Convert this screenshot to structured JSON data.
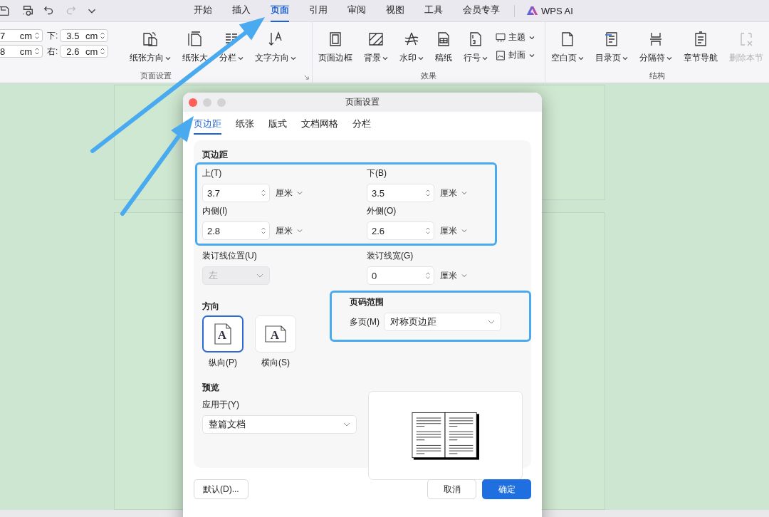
{
  "menu_tabs": [
    {
      "label": "开始",
      "selected": false
    },
    {
      "label": "插入",
      "selected": false
    },
    {
      "label": "页面",
      "selected": true
    },
    {
      "label": "引用",
      "selected": false
    },
    {
      "label": "审阅",
      "selected": false
    },
    {
      "label": "视图",
      "selected": false
    },
    {
      "label": "工具",
      "selected": false
    },
    {
      "label": "会员专享",
      "selected": false
    }
  ],
  "ai_button": {
    "label": "WPS AI"
  },
  "ribbon": {
    "margin_fields": [
      {
        "value": "7",
        "unit": "cm"
      },
      {
        "label": "下:",
        "value": "3.5",
        "unit": "cm"
      },
      {
        "value": "8",
        "unit": "cm"
      },
      {
        "label": "右:",
        "value": "2.6",
        "unit": "cm"
      }
    ],
    "groups": [
      {
        "label": "页面设置",
        "buttons": [
          {
            "label": "纸张方向",
            "dropdown": true,
            "disabled": false
          },
          {
            "label": "纸张大",
            "dropdown": false,
            "disabled": false
          },
          {
            "label": "分栏",
            "dropdown": true,
            "disabled": false
          },
          {
            "label": "文字方向",
            "dropdown": true,
            "disabled": false
          }
        ]
      },
      {
        "label": "效果",
        "buttons": [
          {
            "label": "页面边框",
            "dropdown": false,
            "disabled": false
          },
          {
            "label": "背景",
            "dropdown": true,
            "disabled": false
          },
          {
            "label": "水印",
            "dropdown": true,
            "disabled": false
          },
          {
            "label": "稿纸",
            "dropdown": false,
            "disabled": false
          },
          {
            "label": "行号",
            "dropdown": true,
            "disabled": false
          }
        ],
        "small_buttons": [
          {
            "label": "主题",
            "dropdown": true
          },
          {
            "label": "封面",
            "dropdown": true
          }
        ]
      },
      {
        "label": "结构",
        "buttons": [
          {
            "label": "空白页",
            "dropdown": true,
            "disabled": false
          },
          {
            "label": "目录页",
            "dropdown": true,
            "disabled": false
          },
          {
            "label": "分隔符",
            "dropdown": true,
            "disabled": false
          },
          {
            "label": "章节导航",
            "dropdown": false,
            "disabled": false
          },
          {
            "label": "删除本节",
            "dropdown": false,
            "disabled": true
          }
        ]
      }
    ]
  },
  "dialog": {
    "title": "页面设置",
    "tabs": [
      {
        "label": "页边距",
        "selected": true
      },
      {
        "label": "纸张",
        "selected": false
      },
      {
        "label": "版式",
        "selected": false
      },
      {
        "label": "文档网格",
        "selected": false
      },
      {
        "label": "分栏",
        "selected": false
      }
    ],
    "margins": {
      "heading": "页边距",
      "fields": [
        {
          "label": "上(T)",
          "value": "3.7",
          "unit": "厘米"
        },
        {
          "label": "下(B)",
          "value": "3.5",
          "unit": "厘米"
        },
        {
          "label": "内侧(I)",
          "value": "2.8",
          "unit": "厘米"
        },
        {
          "label": "外侧(O)",
          "value": "2.6",
          "unit": "厘米"
        }
      ]
    },
    "gutter_position": {
      "label": "装订线位置(U)",
      "value": "左",
      "disabled": true
    },
    "gutter_width": {
      "label": "装订线宽(G)",
      "value": "0",
      "unit": "厘米"
    },
    "orientation": {
      "heading": "方向",
      "options": [
        {
          "label": "纵向(P)",
          "icon_letter": "A",
          "selected": true
        },
        {
          "label": "横向(S)",
          "icon_letter": "A",
          "selected": false
        }
      ]
    },
    "page_range": {
      "heading": "页码范围",
      "label": "多页(M)",
      "value": "对称页边距"
    },
    "preview": {
      "heading": "预览",
      "apply_label": "应用于(Y)",
      "apply_value": "整篇文档"
    },
    "buttons": [
      {
        "label": "默认(D)...",
        "kind": "plain"
      },
      {
        "label": "取消",
        "kind": "plain"
      },
      {
        "label": "确定",
        "kind": "primary"
      }
    ]
  }
}
